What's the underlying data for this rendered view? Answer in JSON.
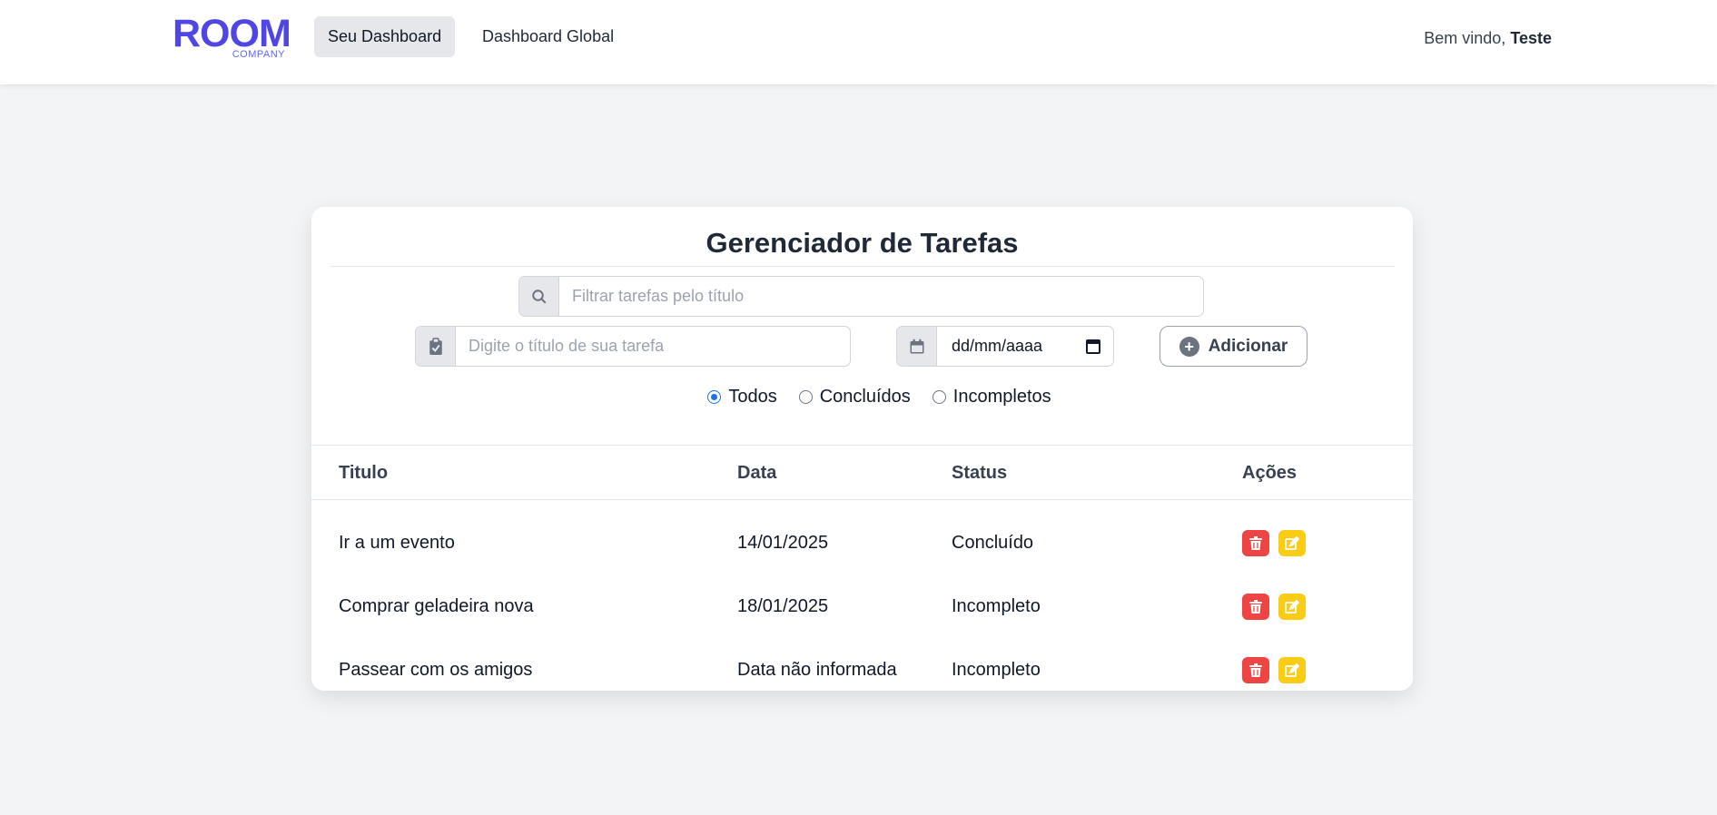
{
  "header": {
    "logo": {
      "word": "ROOM",
      "sub": "COMPANY"
    },
    "nav": {
      "my_dashboard": "Seu Dashboard",
      "global_dashboard": "Dashboard Global"
    },
    "welcome_prefix": "Bem vindo,",
    "user_name": "Teste"
  },
  "card": {
    "title": "Gerenciador de Tarefas",
    "filter": {
      "placeholder": "Filtrar tarefas pelo título",
      "value": "",
      "icon": "search-icon"
    },
    "new_task": {
      "placeholder": "Digite o título de sua tarefa",
      "value": "",
      "icon": "clipboard-check-icon"
    },
    "date_input": {
      "value": "dd/mm/aaaa",
      "icon": "calendar-icon"
    },
    "add_button": {
      "label": "Adicionar",
      "icon": "plus-circle-icon"
    },
    "radio_filters": [
      {
        "label": "Todos",
        "checked": true
      },
      {
        "label": "Concluídos",
        "checked": false
      },
      {
        "label": "Incompletos",
        "checked": false
      }
    ],
    "table": {
      "headers": {
        "title": "Titulo",
        "date": "Data",
        "status": "Status",
        "actions": "Ações"
      },
      "rows": [
        {
          "title": "Ir a um evento",
          "date": "14/01/2025",
          "status": "Concluído"
        },
        {
          "title": "Comprar geladeira nova",
          "date": "18/01/2025",
          "status": "Incompleto"
        },
        {
          "title": "Passear com os amigos",
          "date": "Data não informada",
          "status": "Incompleto"
        }
      ],
      "action_icons": {
        "delete": "trash-icon",
        "edit": "edit-icon"
      }
    }
  },
  "colors": {
    "brand": "#4f46e5",
    "delete": "#ef4444",
    "edit": "#facc15",
    "radio_checked": "#1a73e8"
  }
}
